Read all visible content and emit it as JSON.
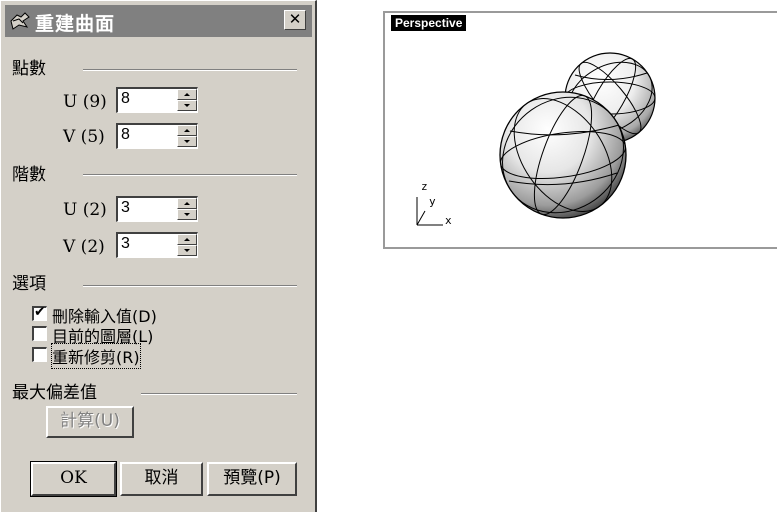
{
  "dialog": {
    "title": "重建曲面",
    "close_label": "✕",
    "points_group": "點數",
    "u_points": {
      "label": "U (9)",
      "value": "8"
    },
    "v_points": {
      "label": "V (5)",
      "value": "8"
    },
    "degree_group": "階數",
    "u_degree": {
      "label": "U (2)",
      "value": "3"
    },
    "v_degree": {
      "label": "V (2)",
      "value": "3"
    },
    "options_group": "選項",
    "options": [
      {
        "label": "刪除輸入值(D)",
        "checked": true
      },
      {
        "label": "目前的圖層(L)",
        "checked": false
      },
      {
        "label": "重新修剪(R)",
        "checked": false
      }
    ],
    "max_deviation_group": "最大偏差值",
    "calculate_button": "計算(U)",
    "ok_button": "OK",
    "cancel_button": "取消",
    "preview_button": "預覽(P)"
  },
  "viewport": {
    "tab_label": "Perspective",
    "axis_labels": {
      "z": "z",
      "y": "y",
      "x": "x"
    }
  }
}
